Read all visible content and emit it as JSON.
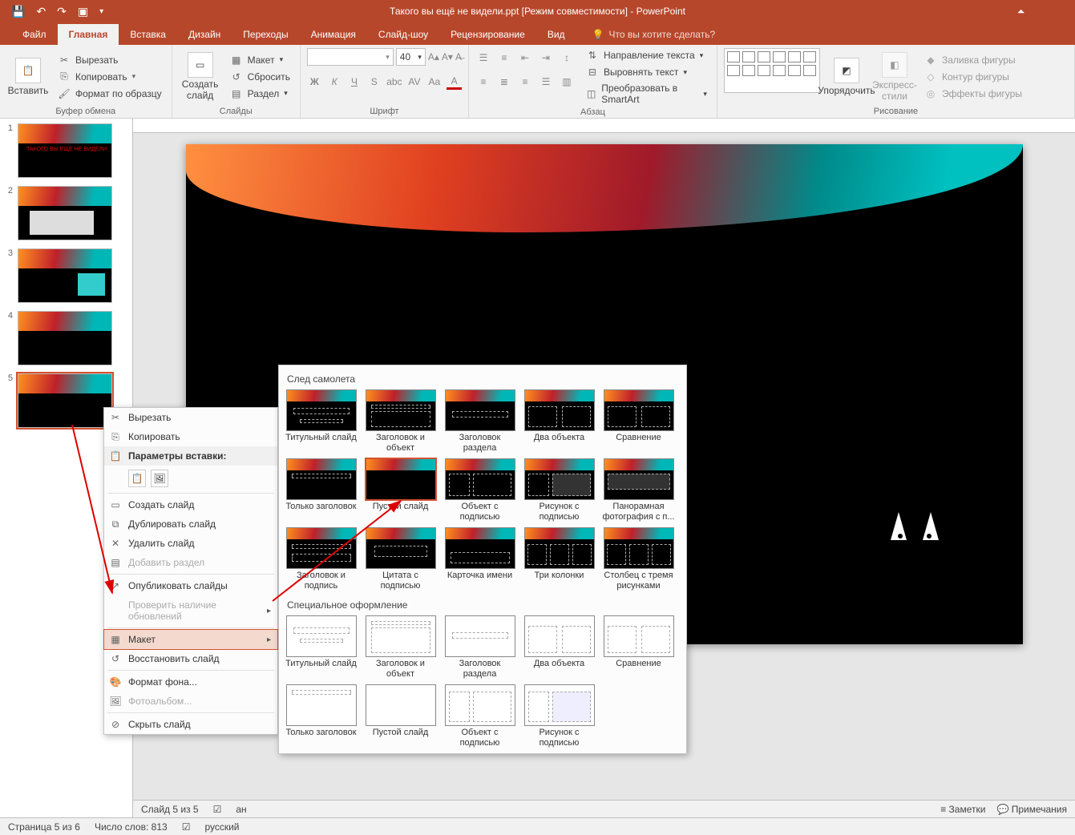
{
  "window": {
    "title": "Такого вы ещё не видели.ppt [Режим совместимости] - PowerPoint"
  },
  "tabs": {
    "file": "Файл",
    "home": "Главная",
    "insert": "Вставка",
    "design": "Дизайн",
    "transitions": "Переходы",
    "animation": "Анимация",
    "slideshow": "Слайд-шоу",
    "review": "Рецензирование",
    "view": "Вид",
    "tellme": "Что вы хотите сделать?"
  },
  "ribbon": {
    "clipboard": {
      "paste": "Вставить",
      "cut": "Вырезать",
      "copy": "Копировать",
      "format_painter": "Формат по образцу",
      "label": "Буфер обмена"
    },
    "slides": {
      "new_slide": "Создать слайд",
      "layout": "Макет",
      "reset": "Сбросить",
      "section": "Раздел",
      "label": "Слайды"
    },
    "font": {
      "size_value": "40",
      "label": "Шрифт"
    },
    "paragraph": {
      "text_direction": "Направление текста",
      "align_text": "Выровнять текст",
      "smart_art": "Преобразовать в SmartArt",
      "label": "Абзац"
    },
    "drawing": {
      "arrange": "Упорядочить",
      "quick_styles": "Экспресс-стили",
      "shape_fill": "Заливка фигуры",
      "shape_outline": "Контур фигуры",
      "shape_effects": "Эффекты фигуры",
      "label": "Рисование"
    }
  },
  "context_menu": {
    "cut": "Вырезать",
    "copy": "Копировать",
    "paste_header": "Параметры вставки:",
    "new_slide": "Создать слайд",
    "duplicate": "Дублировать слайд",
    "delete": "Удалить слайд",
    "add_section": "Добавить раздел",
    "publish": "Опубликовать слайды",
    "check_updates": "Проверить наличие обновлений",
    "layout": "Макет",
    "reset": "Восстановить слайд",
    "format_bg": "Формат фона...",
    "photo_album": "Фотоальбом...",
    "hide_slide": "Скрыть слайд"
  },
  "layout_panel": {
    "section1": "След самолета",
    "section2": "Специальное оформление",
    "row1": {
      "l1": "Титульный слайд",
      "l2": "Заголовок и объект",
      "l3": "Заголовок раздела",
      "l4": "Два объекта",
      "l5": "Сравнение"
    },
    "row2": {
      "l1": "Только заголовок",
      "l2": "Пустой слайд",
      "l3": "Объект с подписью",
      "l4": "Рисунок с подписью",
      "l5": "Панорамная фотография с п..."
    },
    "row3": {
      "l1": "Заголовок и подпись",
      "l2": "Цитата с подписью",
      "l3": "Карточка имени",
      "l4": "Три колонки",
      "l5": "Столбец с тремя рисунками"
    },
    "row4": {
      "l1": "Титульный слайд",
      "l2": "Заголовок и объект",
      "l3": "Заголовок раздела",
      "l4": "Два объекта",
      "l5": "Сравнение"
    },
    "row5": {
      "l1": "Только заголовок",
      "l2": "Пустой слайд",
      "l3": "Объект с подписью",
      "l4": "Рисунок с подписью"
    }
  },
  "status": {
    "slide_indicator": "Слайд 5 из 5",
    "lang": "ан",
    "notes": "Заметки",
    "comments": "Примечания",
    "page": "Страница 5 из 6",
    "words": "Число слов: 813",
    "lang2": "русский"
  },
  "thumbs": {
    "t1": "1",
    "t2": "2",
    "t3": "3",
    "t4": "4",
    "t5": "5"
  }
}
